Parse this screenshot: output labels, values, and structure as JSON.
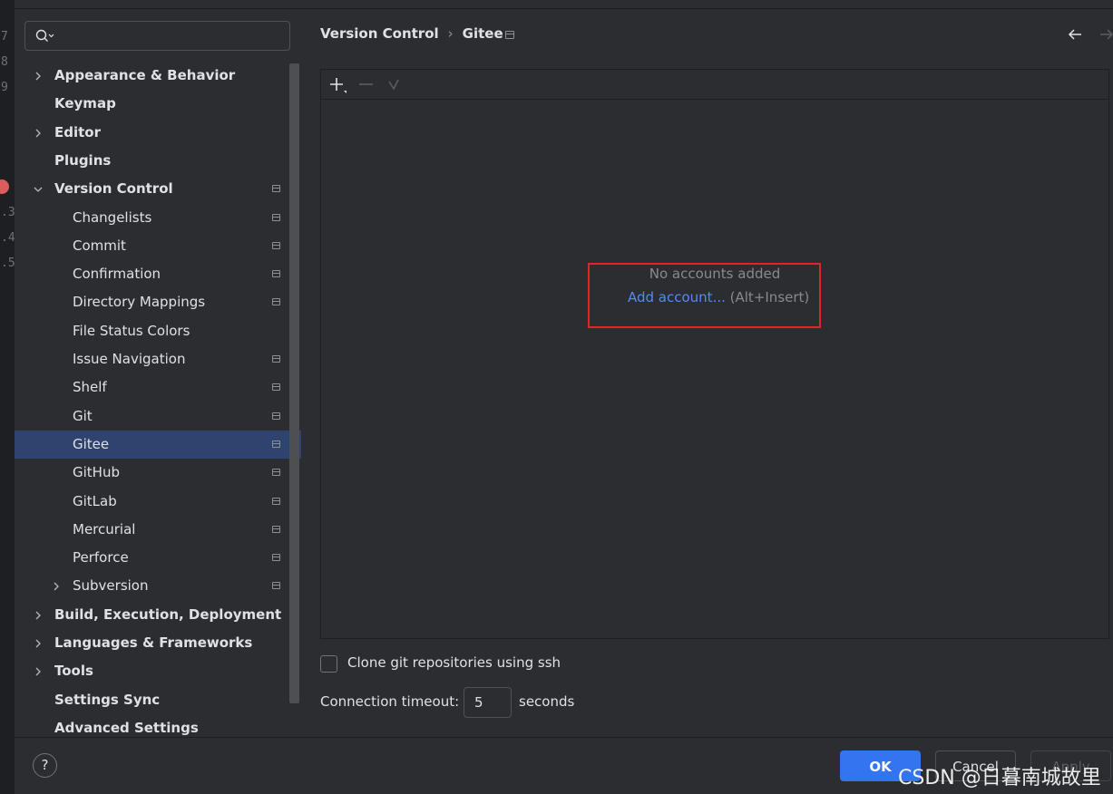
{
  "gutter": {
    "lines": [
      "7",
      "8",
      "9",
      ".3",
      ".4",
      ".5"
    ]
  },
  "sidebar": {
    "search": {
      "placeholder": "",
      "icon": "search-icon"
    },
    "items": [
      {
        "label": "Appearance & Behavior",
        "level": 0,
        "bold": true,
        "expandable": true,
        "expanded": false,
        "project_icon": false
      },
      {
        "label": "Keymap",
        "level": 0,
        "bold": true,
        "expandable": false,
        "project_icon": false
      },
      {
        "label": "Editor",
        "level": 0,
        "bold": true,
        "expandable": true,
        "expanded": false,
        "project_icon": false
      },
      {
        "label": "Plugins",
        "level": 0,
        "bold": true,
        "expandable": false,
        "project_icon": false
      },
      {
        "label": "Version Control",
        "level": 0,
        "bold": true,
        "expandable": true,
        "expanded": true,
        "project_icon": true
      },
      {
        "label": "Changelists",
        "level": 1,
        "bold": false,
        "expandable": false,
        "project_icon": true
      },
      {
        "label": "Commit",
        "level": 1,
        "bold": false,
        "expandable": false,
        "project_icon": true
      },
      {
        "label": "Confirmation",
        "level": 1,
        "bold": false,
        "expandable": false,
        "project_icon": true
      },
      {
        "label": "Directory Mappings",
        "level": 1,
        "bold": false,
        "expandable": false,
        "project_icon": true
      },
      {
        "label": "File Status Colors",
        "level": 1,
        "bold": false,
        "expandable": false,
        "project_icon": false
      },
      {
        "label": "Issue Navigation",
        "level": 1,
        "bold": false,
        "expandable": false,
        "project_icon": true
      },
      {
        "label": "Shelf",
        "level": 1,
        "bold": false,
        "expandable": false,
        "project_icon": true
      },
      {
        "label": "Git",
        "level": 1,
        "bold": false,
        "expandable": false,
        "project_icon": true
      },
      {
        "label": "Gitee",
        "level": 1,
        "bold": false,
        "expandable": false,
        "project_icon": true,
        "selected": true
      },
      {
        "label": "GitHub",
        "level": 1,
        "bold": false,
        "expandable": false,
        "project_icon": true
      },
      {
        "label": "GitLab",
        "level": 1,
        "bold": false,
        "expandable": false,
        "project_icon": true
      },
      {
        "label": "Mercurial",
        "level": 1,
        "bold": false,
        "expandable": false,
        "project_icon": true
      },
      {
        "label": "Perforce",
        "level": 1,
        "bold": false,
        "expandable": false,
        "project_icon": true
      },
      {
        "label": "Subversion",
        "level": 1,
        "bold": false,
        "expandable": true,
        "expanded": false,
        "project_icon": true
      },
      {
        "label": "Build, Execution, Deployment",
        "level": 0,
        "bold": true,
        "expandable": true,
        "expanded": false,
        "project_icon": false
      },
      {
        "label": "Languages & Frameworks",
        "level": 0,
        "bold": true,
        "expandable": true,
        "expanded": false,
        "project_icon": false
      },
      {
        "label": "Tools",
        "level": 0,
        "bold": true,
        "expandable": true,
        "expanded": false,
        "project_icon": false
      },
      {
        "label": "Settings Sync",
        "level": 0,
        "bold": true,
        "expandable": false,
        "project_icon": false
      },
      {
        "label": "Advanced Settings",
        "level": 0,
        "bold": true,
        "expandable": false,
        "project_icon": false
      }
    ]
  },
  "header": {
    "breadcrumb_parent": "Version Control",
    "breadcrumb_separator": "›",
    "breadcrumb_current": "Gitee",
    "back_icon": "arrow-left-icon",
    "forward_icon": "arrow-right-icon"
  },
  "accounts": {
    "toolbar": {
      "add_icon": "plus-icon",
      "remove_icon": "minus-icon",
      "default_icon": "check-icon"
    },
    "empty_text": "No accounts added",
    "add_link": "Add account...",
    "add_shortcut": "(Alt+Insert)"
  },
  "options": {
    "clone_ssh_label": "Clone git repositories using ssh",
    "clone_ssh_checked": false,
    "timeout_label": "Connection timeout:",
    "timeout_value": "5",
    "timeout_unit": "seconds"
  },
  "footer": {
    "help_label": "?",
    "ok_label": "OK",
    "cancel_label": "Cancel",
    "apply_label": "Apply"
  },
  "watermark": "CSDN @日暮南城故里",
  "colors": {
    "background": "#2b2d30",
    "selection": "#2e436e",
    "link": "#548af7",
    "primary_button": "#3574f0",
    "highlight_box": "#e0242c"
  }
}
